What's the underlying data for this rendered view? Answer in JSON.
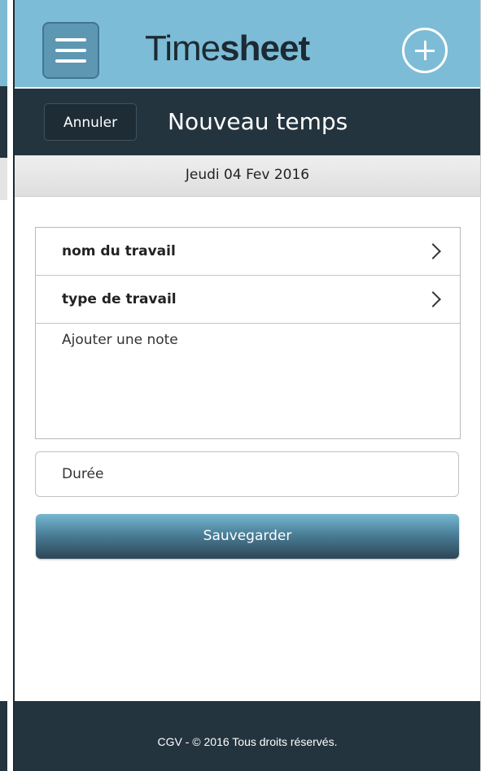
{
  "header": {
    "brand_light": "Time",
    "brand_bold": "sheet",
    "menu_icon": "hamburger-menu-icon",
    "add_icon": "plus-circle-icon",
    "color": "#7dbcd6"
  },
  "subheader": {
    "cancel_label": "Annuler",
    "title": "Nouveau temps",
    "color": "#24343f"
  },
  "date_label": "Jeudi 04 Fev 2016",
  "form": {
    "job_name_label": "nom du travail",
    "job_type_label": "type de travail",
    "note_placeholder": "Ajouter une note",
    "duration_placeholder": "Durée",
    "save_label": "Sauvegarder",
    "chevron_icon": "chevron-right-icon"
  },
  "footer": {
    "text": "CGV - © 2016 Tous droits réservés."
  }
}
